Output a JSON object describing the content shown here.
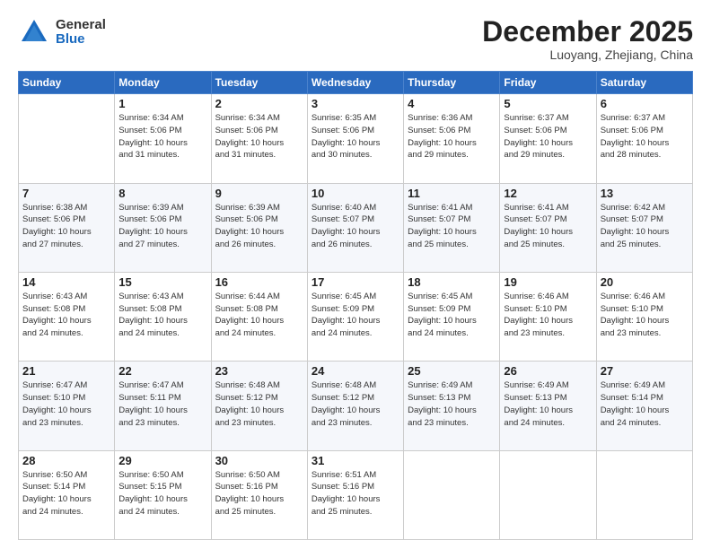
{
  "header": {
    "logo_general": "General",
    "logo_blue": "Blue",
    "month": "December 2025",
    "location": "Luoyang, Zhejiang, China"
  },
  "days_of_week": [
    "Sunday",
    "Monday",
    "Tuesday",
    "Wednesday",
    "Thursday",
    "Friday",
    "Saturday"
  ],
  "weeks": [
    [
      {
        "day": "",
        "info": ""
      },
      {
        "day": "1",
        "info": "Sunrise: 6:34 AM\nSunset: 5:06 PM\nDaylight: 10 hours\nand 31 minutes."
      },
      {
        "day": "2",
        "info": "Sunrise: 6:34 AM\nSunset: 5:06 PM\nDaylight: 10 hours\nand 31 minutes."
      },
      {
        "day": "3",
        "info": "Sunrise: 6:35 AM\nSunset: 5:06 PM\nDaylight: 10 hours\nand 30 minutes."
      },
      {
        "day": "4",
        "info": "Sunrise: 6:36 AM\nSunset: 5:06 PM\nDaylight: 10 hours\nand 29 minutes."
      },
      {
        "day": "5",
        "info": "Sunrise: 6:37 AM\nSunset: 5:06 PM\nDaylight: 10 hours\nand 29 minutes."
      },
      {
        "day": "6",
        "info": "Sunrise: 6:37 AM\nSunset: 5:06 PM\nDaylight: 10 hours\nand 28 minutes."
      }
    ],
    [
      {
        "day": "7",
        "info": "Sunrise: 6:38 AM\nSunset: 5:06 PM\nDaylight: 10 hours\nand 27 minutes."
      },
      {
        "day": "8",
        "info": "Sunrise: 6:39 AM\nSunset: 5:06 PM\nDaylight: 10 hours\nand 27 minutes."
      },
      {
        "day": "9",
        "info": "Sunrise: 6:39 AM\nSunset: 5:06 PM\nDaylight: 10 hours\nand 26 minutes."
      },
      {
        "day": "10",
        "info": "Sunrise: 6:40 AM\nSunset: 5:07 PM\nDaylight: 10 hours\nand 26 minutes."
      },
      {
        "day": "11",
        "info": "Sunrise: 6:41 AM\nSunset: 5:07 PM\nDaylight: 10 hours\nand 25 minutes."
      },
      {
        "day": "12",
        "info": "Sunrise: 6:41 AM\nSunset: 5:07 PM\nDaylight: 10 hours\nand 25 minutes."
      },
      {
        "day": "13",
        "info": "Sunrise: 6:42 AM\nSunset: 5:07 PM\nDaylight: 10 hours\nand 25 minutes."
      }
    ],
    [
      {
        "day": "14",
        "info": "Sunrise: 6:43 AM\nSunset: 5:08 PM\nDaylight: 10 hours\nand 24 minutes."
      },
      {
        "day": "15",
        "info": "Sunrise: 6:43 AM\nSunset: 5:08 PM\nDaylight: 10 hours\nand 24 minutes."
      },
      {
        "day": "16",
        "info": "Sunrise: 6:44 AM\nSunset: 5:08 PM\nDaylight: 10 hours\nand 24 minutes."
      },
      {
        "day": "17",
        "info": "Sunrise: 6:45 AM\nSunset: 5:09 PM\nDaylight: 10 hours\nand 24 minutes."
      },
      {
        "day": "18",
        "info": "Sunrise: 6:45 AM\nSunset: 5:09 PM\nDaylight: 10 hours\nand 24 minutes."
      },
      {
        "day": "19",
        "info": "Sunrise: 6:46 AM\nSunset: 5:10 PM\nDaylight: 10 hours\nand 23 minutes."
      },
      {
        "day": "20",
        "info": "Sunrise: 6:46 AM\nSunset: 5:10 PM\nDaylight: 10 hours\nand 23 minutes."
      }
    ],
    [
      {
        "day": "21",
        "info": "Sunrise: 6:47 AM\nSunset: 5:10 PM\nDaylight: 10 hours\nand 23 minutes."
      },
      {
        "day": "22",
        "info": "Sunrise: 6:47 AM\nSunset: 5:11 PM\nDaylight: 10 hours\nand 23 minutes."
      },
      {
        "day": "23",
        "info": "Sunrise: 6:48 AM\nSunset: 5:12 PM\nDaylight: 10 hours\nand 23 minutes."
      },
      {
        "day": "24",
        "info": "Sunrise: 6:48 AM\nSunset: 5:12 PM\nDaylight: 10 hours\nand 23 minutes."
      },
      {
        "day": "25",
        "info": "Sunrise: 6:49 AM\nSunset: 5:13 PM\nDaylight: 10 hours\nand 23 minutes."
      },
      {
        "day": "26",
        "info": "Sunrise: 6:49 AM\nSunset: 5:13 PM\nDaylight: 10 hours\nand 24 minutes."
      },
      {
        "day": "27",
        "info": "Sunrise: 6:49 AM\nSunset: 5:14 PM\nDaylight: 10 hours\nand 24 minutes."
      }
    ],
    [
      {
        "day": "28",
        "info": "Sunrise: 6:50 AM\nSunset: 5:14 PM\nDaylight: 10 hours\nand 24 minutes."
      },
      {
        "day": "29",
        "info": "Sunrise: 6:50 AM\nSunset: 5:15 PM\nDaylight: 10 hours\nand 24 minutes."
      },
      {
        "day": "30",
        "info": "Sunrise: 6:50 AM\nSunset: 5:16 PM\nDaylight: 10 hours\nand 25 minutes."
      },
      {
        "day": "31",
        "info": "Sunrise: 6:51 AM\nSunset: 5:16 PM\nDaylight: 10 hours\nand 25 minutes."
      },
      {
        "day": "",
        "info": ""
      },
      {
        "day": "",
        "info": ""
      },
      {
        "day": "",
        "info": ""
      }
    ]
  ]
}
